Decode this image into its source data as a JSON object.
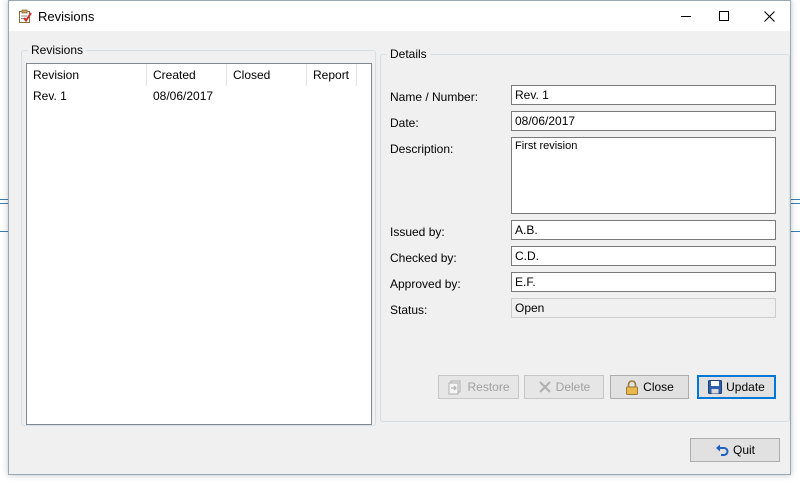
{
  "window": {
    "title": "Revisions",
    "icon": "clipboard-check-icon",
    "controls": {
      "minimize": "minimize-icon",
      "maximize": "maximize-icon",
      "close": "close-icon"
    }
  },
  "revisions_group": {
    "legend": "Revisions",
    "columns": [
      "Revision",
      "Created",
      "Closed",
      "Report"
    ],
    "rows": [
      {
        "revision": "Rev. 1",
        "created": "08/06/2017",
        "closed": "",
        "report": ""
      }
    ]
  },
  "details_group": {
    "legend": "Details",
    "name_label": "Name / Number:",
    "name_value": "Rev. 1",
    "date_label": "Date:",
    "date_value": "08/06/2017",
    "description_label": "Description:",
    "description_value": "First revision",
    "issued_label": "Issued by:",
    "issued_value": "A.B.",
    "checked_label": "Checked by:",
    "checked_value": "C.D.",
    "approved_label": "Approved by:",
    "approved_value": "E.F.",
    "status_label": "Status:",
    "status_value": "Open"
  },
  "buttons": {
    "restore": "Restore",
    "delete": "Delete",
    "close": "Close",
    "update": "Update",
    "quit": "Quit"
  },
  "colors": {
    "accent": "#0078d7",
    "window_bg": "#f0f0f0",
    "disabled_text": "#a0a0a0"
  }
}
